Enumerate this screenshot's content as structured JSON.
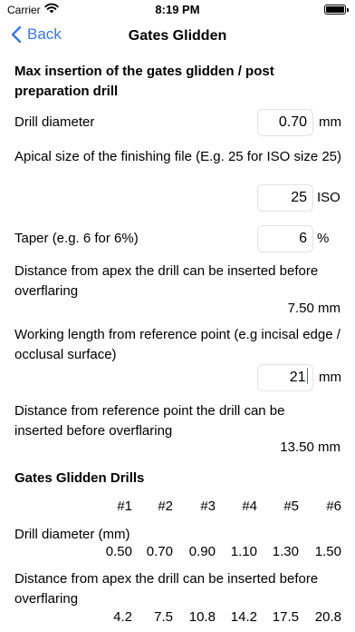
{
  "status": {
    "carrier": "Carrier",
    "time": "8:19 PM"
  },
  "nav": {
    "back_label": "Back",
    "title": "Gates Glidden"
  },
  "section1": {
    "title": "Max insertion of the gates glidden / post preparation drill",
    "drill_diameter": {
      "label": "Drill diameter",
      "value": "0.70",
      "unit": "mm"
    },
    "apical_size": {
      "label": "Apical size of the finishing file (E.g. 25 for ISO size 25)",
      "value": "25",
      "unit": "ISO"
    },
    "taper": {
      "label": "Taper (e.g. 6 for 6%)",
      "value": "6",
      "unit": "%"
    },
    "distance_apex": {
      "label": "Distance from apex the drill can be inserted before overflaring",
      "value": "7.50 mm"
    },
    "working_length": {
      "label": "Working length from reference point (e.g incisal edge / occlusal surface)",
      "value": "21",
      "unit": "mm"
    },
    "distance_ref": {
      "label": "Distance from reference point the drill can be inserted before overflaring",
      "value": "13.50 mm"
    }
  },
  "section2": {
    "title": "Gates Glidden Drills",
    "columns": [
      "#1",
      "#2",
      "#3",
      "#4",
      "#5",
      "#6"
    ],
    "diameter_label": "Drill diameter (mm)",
    "diameters": [
      "0.50",
      "0.70",
      "0.90",
      "1.10",
      "1.30",
      "1.50"
    ],
    "distance_label": "Distance from apex the drill can be inserted before overflaring",
    "distances": [
      "4.2",
      "7.5",
      "10.8",
      "14.2",
      "17.5",
      "20.8"
    ]
  },
  "colors": {
    "accent": "#3478f6",
    "field_border": "#e3e3e8"
  }
}
